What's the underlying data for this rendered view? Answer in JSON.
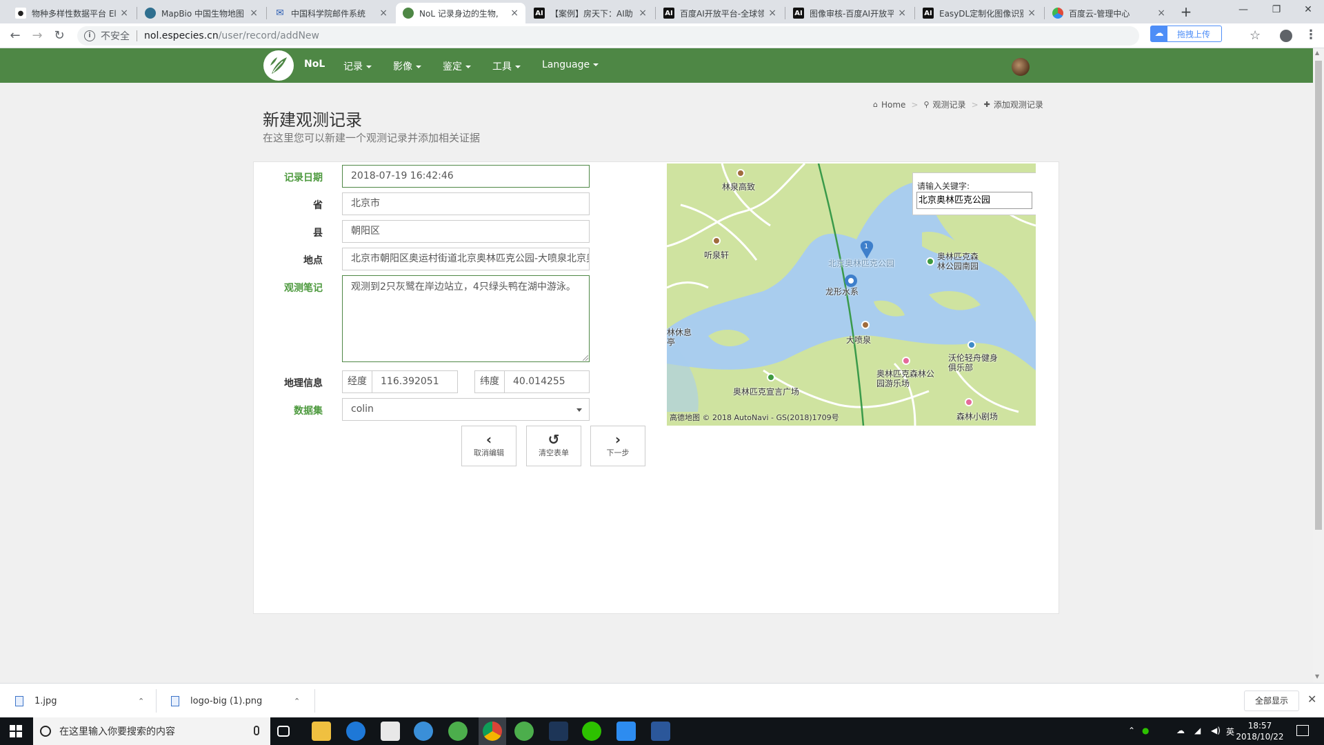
{
  "browser": {
    "tabs": [
      {
        "label": "物种多样性数据平台 El",
        "icon": "panda-icon",
        "color": "#222222"
      },
      {
        "label": "MapBio 中国生物地图",
        "icon": "globe-icon",
        "color": "#2f6f8f"
      },
      {
        "label": "中国科学院邮件系统",
        "icon": "mail-icon",
        "color": "#2d5fb4"
      },
      {
        "label": "NoL 记录身边的生物,",
        "icon": "leaf-icon",
        "color": "#4e8745",
        "active": true
      },
      {
        "label": "【案例】房天下：AI助",
        "icon": "ai-icon",
        "color": "#111111"
      },
      {
        "label": "百度AI开放平台-全球领",
        "icon": "ai-icon",
        "color": "#111111"
      },
      {
        "label": "图像审核-百度AI开放平",
        "icon": "ai-icon",
        "color": "#111111"
      },
      {
        "label": "EasyDL定制化图像识别",
        "icon": "ai-icon",
        "color": "#111111"
      },
      {
        "label": "百度云-管理中心",
        "icon": "cloud-icon",
        "color": "#e04b3a"
      }
    ],
    "tab_close": "×",
    "new_tab": "+",
    "window_controls": {
      "minimize": "—",
      "maximize": "❐",
      "close": "✕"
    },
    "address": {
      "security_label": "不安全",
      "url_host": "nol.especies.cn",
      "url_path": "/user/record/addNew"
    },
    "extension_label": "拖拽上传"
  },
  "site": {
    "brand": "NoL",
    "nav": [
      {
        "label": "记录"
      },
      {
        "label": "影像"
      },
      {
        "label": "鉴定"
      },
      {
        "label": "工具"
      },
      {
        "label": "Language"
      }
    ]
  },
  "page": {
    "title": "新建观测记录",
    "subtitle": "在这里您可以新建一个观测记录并添加相关证据",
    "breadcrumb": [
      "Home",
      "观测记录",
      "添加观测记录"
    ]
  },
  "form": {
    "date": {
      "label": "记录日期",
      "value": "2018-07-19 16:42:46"
    },
    "province": {
      "label": "省",
      "value": "北京市"
    },
    "county": {
      "label": "县",
      "value": "朝阳区"
    },
    "location": {
      "label": "地点",
      "value": "北京市朝阳区奥运村街道北京奥林匹克公园-大喷泉北京奥林匹"
    },
    "notes": {
      "label": "观测笔记",
      "value": "观测到2只灰鹭在岸边站立，4只绿头鸭在湖中游泳。"
    },
    "geo": {
      "label": "地理信息",
      "lng_label": "经度",
      "lng_value": "116.392051",
      "lat_label": "纬度",
      "lat_value": "40.014255"
    },
    "dataset": {
      "label": "数据集",
      "value": "colin"
    },
    "buttons": {
      "cancel": "取消编辑",
      "clear": "清空表单",
      "next": "下一步"
    }
  },
  "map": {
    "search_label": "请输入关键字:",
    "search_value": "北京奥林匹克公园",
    "marker_number": "1",
    "labels": {
      "linquan": "林泉高致",
      "tingquan": "听泉轩",
      "park": "北京奥林匹克公园",
      "longxing": "龙形水系",
      "forest_south": "奥林匹克森林公园南园",
      "dapenquan": "大喷泉",
      "volvo": "沃伦轻舟健身俱乐部",
      "forest_play": "奥林匹克森林公园游乐场",
      "square": "奥林匹克宣言广场",
      "theater": "森林小剧场",
      "rest": "林休息亭"
    },
    "copyright": "高德地图 © 2018 AutoNavi - GS(2018)1709号"
  },
  "downloads": {
    "items": [
      {
        "name": "1.jpg"
      },
      {
        "name": "logo-big (1).png"
      }
    ],
    "show_all": "全部显示"
  },
  "taskbar": {
    "search_placeholder": "在这里输入你要搜索的内容",
    "tray_lang": "英",
    "time": "18:57",
    "date": "2018/10/22"
  }
}
